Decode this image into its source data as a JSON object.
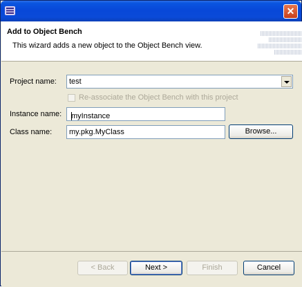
{
  "window": {
    "title": ""
  },
  "header": {
    "title": "Add to Object Bench",
    "description": "This wizard adds a new object to the Object Bench view."
  },
  "form": {
    "project_label": "Project name:",
    "project_value": "test",
    "reassociate_label": "Re-associate the Object Bench with this project",
    "reassociate_checked": false,
    "instance_label": "Instance name:",
    "instance_value": "myInstance",
    "class_label": "Class name:",
    "class_value": "my.pkg.MyClass",
    "browse_label": "Browse..."
  },
  "footer": {
    "back_label": "< Back",
    "next_label": "Next >",
    "finish_label": "Finish",
    "cancel_label": "Cancel"
  },
  "icons": {
    "app": "eclipse-app-icon",
    "close": "close-icon",
    "dropdown": "chevron-down-icon"
  }
}
